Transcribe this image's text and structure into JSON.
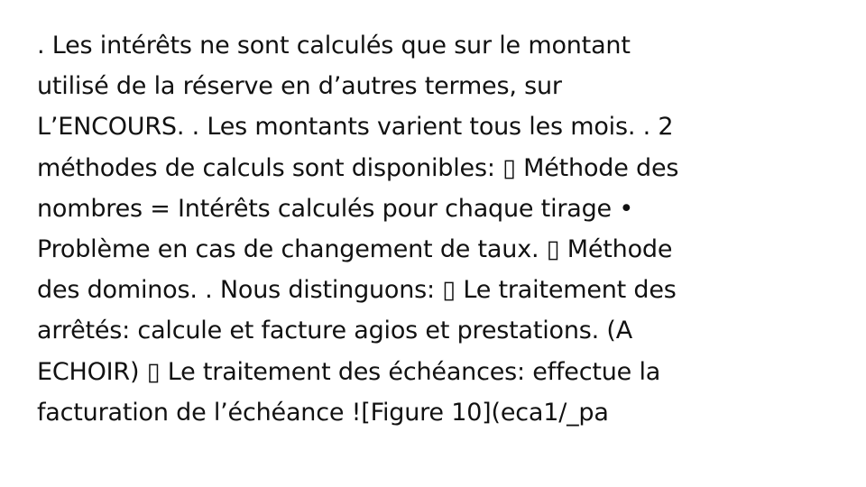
{
  "slide": {
    "lines": [
      ". Les intérêts ne sont calculés que sur le montant",
      "utilisé de la réserve en d’autres termes, sur",
      "L’ENCOURS. . Les montants varient tous les mois. . 2",
      "méthodes de calculs sont disponibles: ▯ Méthode des",
      "nombres = Intérêts calculés pour chaque tirage •",
      "Problème en cas de changement de taux. ▯ Méthode",
      "des dominos. . Nous distinguons: ▯ Le traitement des",
      "arrêtés: calcule et facture agios et prestations. (A",
      "ECHOIR) ▯ Le traitement des échéances: effectue la",
      "facturation de l’échéance ![Figure 10](eca1/_pa"
    ]
  }
}
